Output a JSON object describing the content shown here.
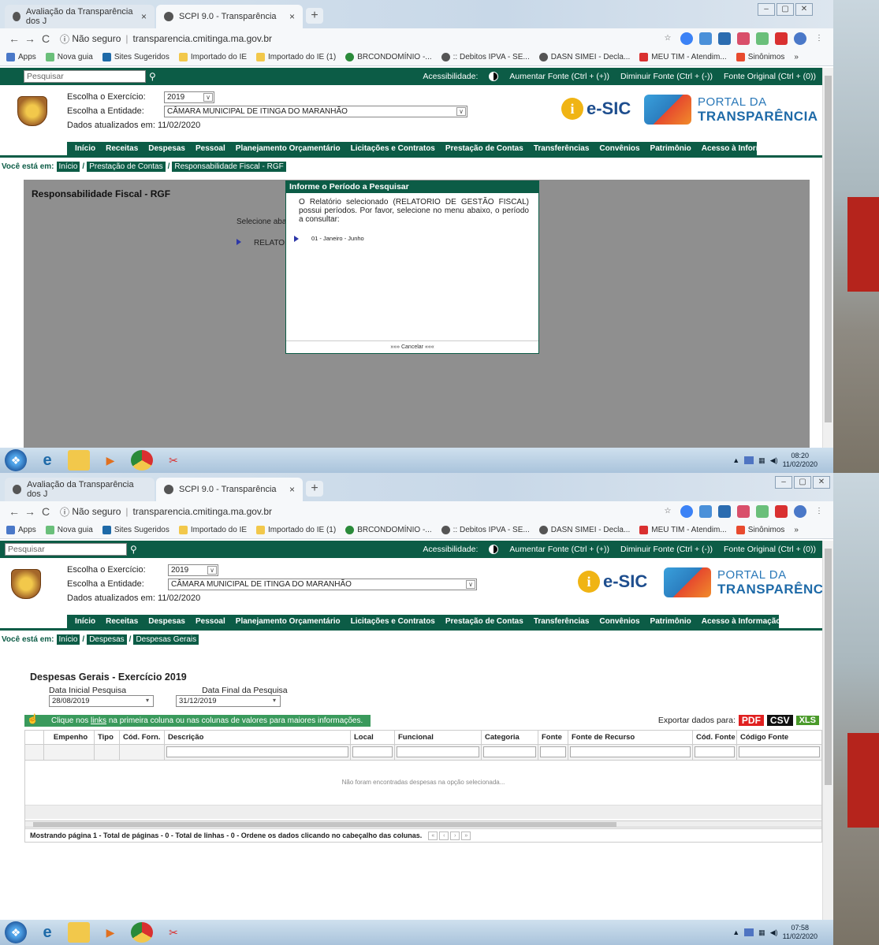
{
  "browser": {
    "tab1": "Avaliação da Transparência dos J",
    "tab2": "SCPI 9.0 - Transparência",
    "tab_close": "×",
    "new_tab": "+",
    "security": "Não seguro",
    "url": "transparencia.cmitinga.ma.gov.br",
    "bookmarks": [
      "Apps",
      "Nova guia",
      "Sites Sugeridos",
      "Importado do IE",
      "Importado do IE (1)",
      "BRCONDOMÍNIO -...",
      ":: Debitos IPVA - SE...",
      "DASN SIMEI - Decla...",
      "MEU TIM - Atendim...",
      "Sinônimos"
    ],
    "more": "»"
  },
  "site": {
    "search_placeholder": "Pesquisar",
    "accessibility": "Acessibilidade:",
    "font_up": "Aumentar Fonte (Ctrl + (+))",
    "font_down": "Diminuir Fonte (Ctrl + (-))",
    "font_orig": "Fonte Original (Ctrl + (0))",
    "exercise_label": "Escolha o Exercício:",
    "exercise_value": "2019",
    "entity_label": "Escolha a Entidade:",
    "entity_value": "CÂMARA MUNICIPAL DE ITINGA DO MARANHÃO",
    "updated": "Dados atualizados em: 11/02/2020",
    "esic": "e-SIC",
    "portal1": "PORTAL DA",
    "portal2": "TRANSPARÊNCIA",
    "nav": [
      "Início",
      "Receitas",
      "Despesas",
      "Pessoal",
      "Planejamento Orçamentário",
      "Licitações e Contratos",
      "Prestação de Contas",
      "Transferências",
      "Convênios",
      "Patrimônio",
      "Acesso à Informação"
    ],
    "crumb_label": "Você está em:",
    "crumb_sep": "/"
  },
  "shot1": {
    "crumbs": [
      "Início",
      "Prestação de Contas",
      "Responsabilidade Fiscal - RGF"
    ],
    "page_title": "Responsabilidade Fiscal - RGF",
    "select_text": "Selecione aba",
    "report_text": "RELATOR",
    "modal_title": "Informe o Período a Pesquisar",
    "modal_body": "O Relatório selecionado (RELATORIO DE GESTÃO FISCAL) possui períodos. Por favor, selecione no menu abaixo, o período a consultar:",
    "modal_option": "01 - Janeiro - Junho",
    "modal_cancel": "»»» Cancelar «««",
    "clock_time": "08:20",
    "clock_date": "11/02/2020"
  },
  "shot2": {
    "crumbs": [
      "Início",
      "Despesas",
      "Despesas Gerais"
    ],
    "page_title": "Despesas Gerais - Exercício 2019",
    "start_label": "Data Inicial Pesquisa",
    "end_label": "Data Final da Pesquisa",
    "start_value": "28/08/2019",
    "end_value": "31/12/2019",
    "info_pre": "Clique nos ",
    "info_link": "links",
    "info_post": " na primeira coluna ou nas colunas de valores para maiores informações.",
    "export_label": "Exportar dados para:",
    "pdf": "PDF",
    "csv": "CSV",
    "xls": "XLS",
    "columns": [
      "Empenho",
      "Tipo",
      "Cód. Forn.",
      "Descrição",
      "Local",
      "Funcional",
      "Categoria",
      "Fonte",
      "Fonte de Recurso",
      "Cód. Fonte",
      "Código Fonte"
    ],
    "empty": "Não foram encontradas despesas na opção selecionada...",
    "footer": "Mostrando página 1 - Total de páginas - 0 - Total de linhas - 0 - Ordene os dados clicando no cabeçalho das colunas.",
    "pager": [
      "«",
      "‹",
      "›",
      "»"
    ],
    "clock_time": "07:58",
    "clock_date": "11/02/2020"
  },
  "colors": {
    "green": "#0c5c46",
    "info_green": "#3a9a5c"
  }
}
